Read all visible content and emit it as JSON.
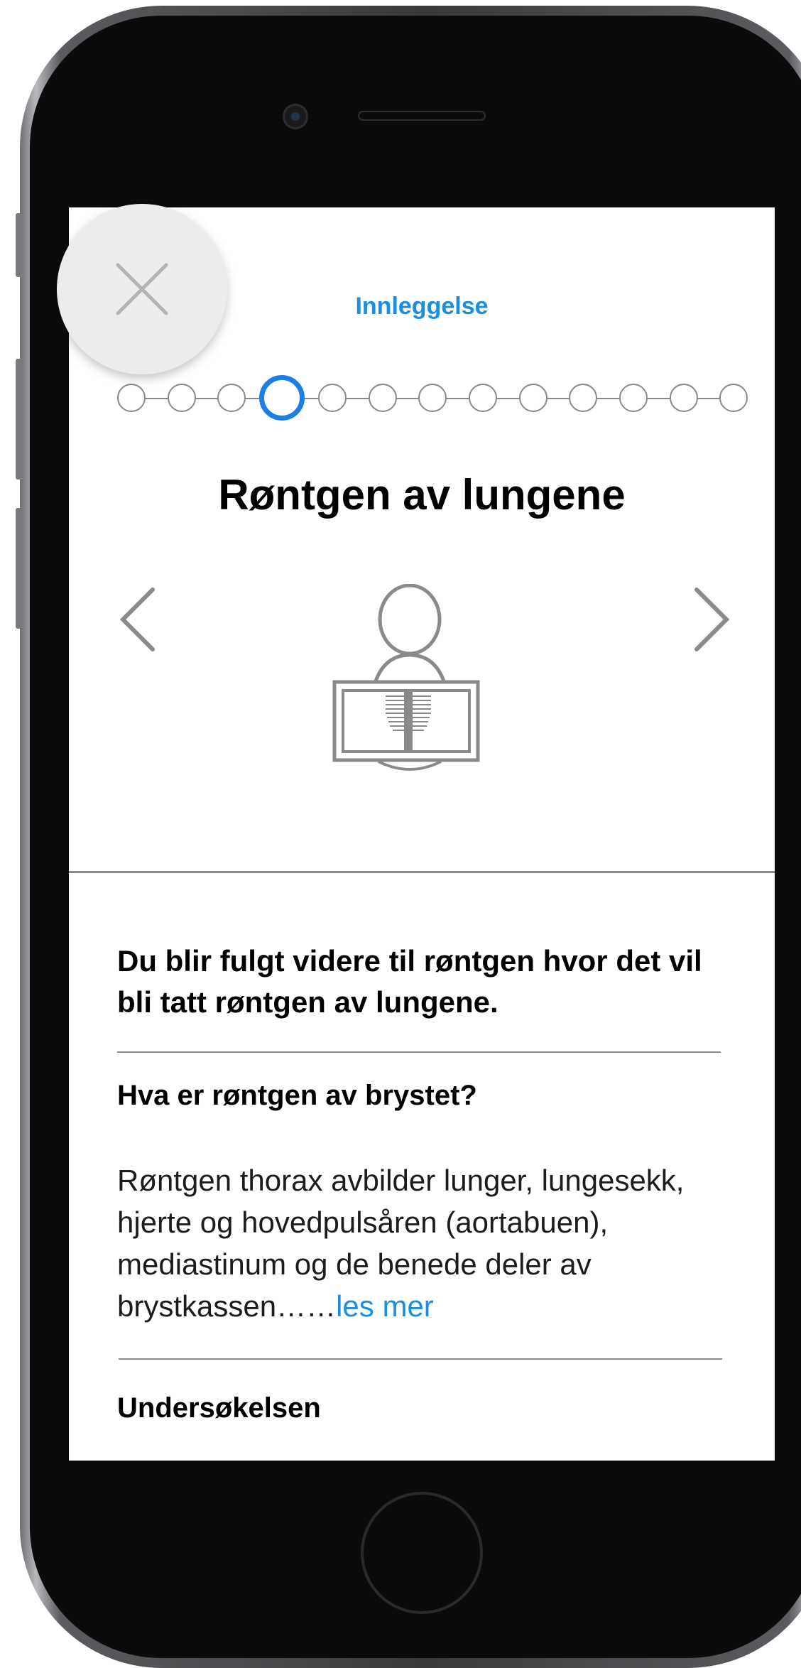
{
  "header": {
    "title": "Innleggelse"
  },
  "stepper": {
    "total_steps": 13,
    "current_step": 4
  },
  "page": {
    "heading": "Røntgen av lungene"
  },
  "content": {
    "lead": "Du blir fulgt videre til røntgen hvor det vil bli tatt røntgen av lungene.",
    "section1_heading": "Hva er røntgen av brystet?",
    "section1_body": "Røntgen thorax avbilder lunger, lungesekk, hjerte og hovedpulsåren (aortabuen), mediastinum og de benede deler av brystkassen……",
    "read_more_label": "les mer",
    "section2_heading": "Undersøkelsen"
  },
  "icons": {
    "close": "close-icon",
    "prev": "chevron-left-icon",
    "next": "chevron-right-icon",
    "illustration": "chest-xray-icon"
  },
  "colors": {
    "accent": "#1a8fe0",
    "active_step": "#1a7fe6",
    "divider": "#8c8c8c"
  }
}
